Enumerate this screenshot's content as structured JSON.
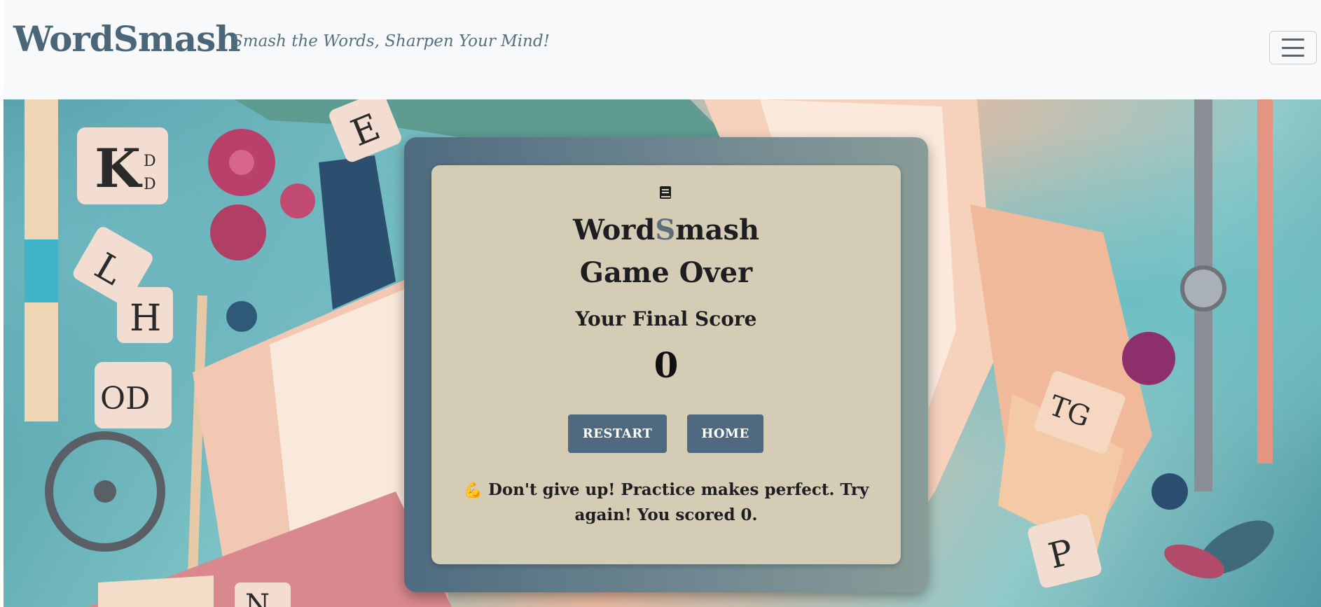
{
  "navbar": {
    "brand": "WordSmash",
    "tagline": "Smash the Words, Sharpen Your Mind!"
  },
  "card": {
    "icon": "book-icon",
    "title_prefix": "Word",
    "title_accent": "S",
    "title_suffix": "mash",
    "subtitle": "Game Over",
    "score_label": "Your Final Score",
    "score": "0",
    "restart_label": "RESTART",
    "home_label": "HOME",
    "message_emoji": "💪",
    "message": "Don't give up! Practice makes perfect. Try again! You scored 0."
  },
  "hero_tiles": [
    "K",
    "D",
    "D",
    "E",
    "L",
    "H",
    "OD",
    "TG",
    "P",
    "N"
  ],
  "colors": {
    "brand": "#4a6678",
    "button": "#4f6a80",
    "card_bg": "#d5ccb5",
    "card_frame": "#4e6c80"
  }
}
